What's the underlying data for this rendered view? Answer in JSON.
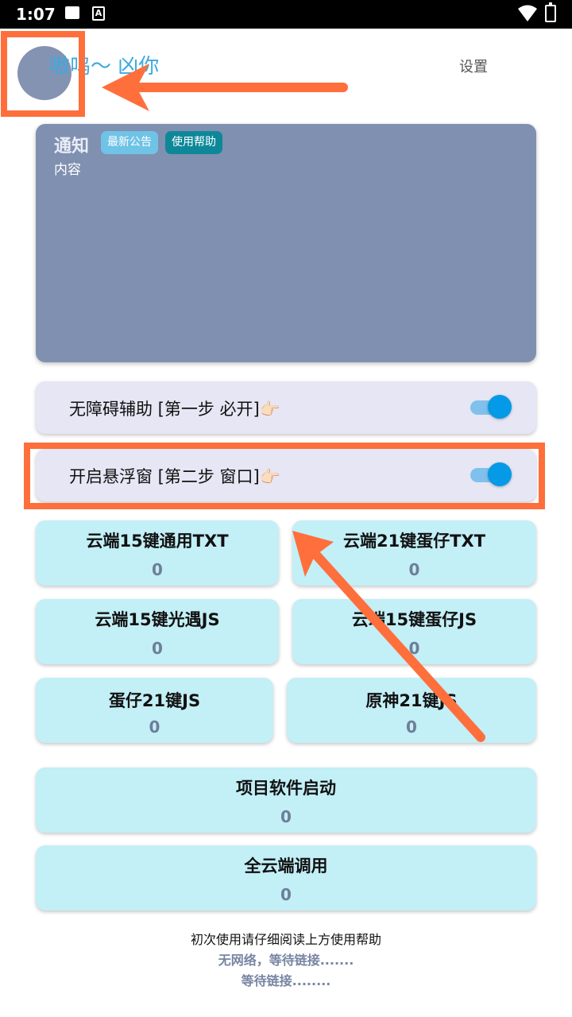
{
  "status_bar": {
    "time": "1:07",
    "a_icon": "A"
  },
  "header": {
    "title": "嗷呜～ 凶你",
    "settings_label": "设置"
  },
  "notice": {
    "title": "通知",
    "badge_news": "最新公告",
    "badge_help": "使用帮助",
    "content": "内容"
  },
  "toggles": [
    {
      "label": "无障碍辅助 [第一步 必开]👉🏻",
      "on": true
    },
    {
      "label": "开启悬浮窗 [第二步 窗口]👉🏻",
      "on": true
    }
  ],
  "cards": [
    {
      "label": "云端15键通用TXT",
      "count": "0"
    },
    {
      "label": "云端21键蛋仔TXT",
      "count": "0"
    },
    {
      "label": "云端15键光遇JS",
      "count": "0"
    },
    {
      "label": "云端15键蛋仔JS",
      "count": "0"
    },
    {
      "label": "蛋仔21键JS",
      "count": "0"
    },
    {
      "label": "原神21键JS",
      "count": "0"
    },
    {
      "label": "项目软件启动",
      "count": "0"
    },
    {
      "label": "全云端调用",
      "count": "0"
    }
  ],
  "footer": {
    "line1": "初次使用请仔细阅读上方使用帮助",
    "line2": "无网络，等待链接.......",
    "line3": "等待链接........"
  },
  "colors": {
    "accent": "#3da9df",
    "notice_bg": "#8090b0",
    "card_bg": "#c3eff6",
    "toggle_bg": "#e6e6f5",
    "switch_on": "#049ae8",
    "annotation": "#ff6f3c"
  }
}
